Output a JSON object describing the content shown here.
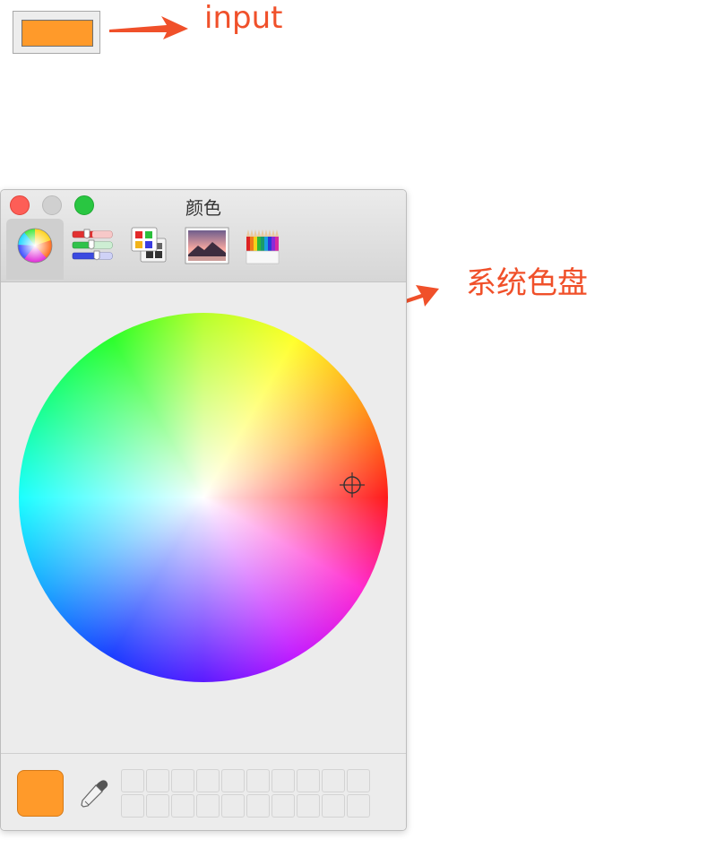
{
  "annotations": {
    "input_label": "input",
    "picker_label": "系统色盘",
    "color": "#f0502a"
  },
  "color_input": {
    "value": "#ff9a2a"
  },
  "color_panel": {
    "title": "颜色",
    "modes": [
      {
        "name": "color-wheel",
        "icon": "color-wheel-icon",
        "selected": true
      },
      {
        "name": "color-sliders",
        "icon": "sliders-icon",
        "selected": false
      },
      {
        "name": "color-palettes",
        "icon": "palettes-icon",
        "selected": false
      },
      {
        "name": "image-palettes",
        "icon": "image-icon",
        "selected": false
      },
      {
        "name": "pencils",
        "icon": "pencils-icon",
        "selected": false
      }
    ],
    "brightness": 1.0,
    "current_color": "#ff9a2a",
    "swatches": [
      "",
      "",
      "",
      "",
      "",
      "",
      "",
      "",
      "",
      "",
      "",
      "",
      "",
      "",
      "",
      "",
      "",
      "",
      "",
      ""
    ]
  }
}
